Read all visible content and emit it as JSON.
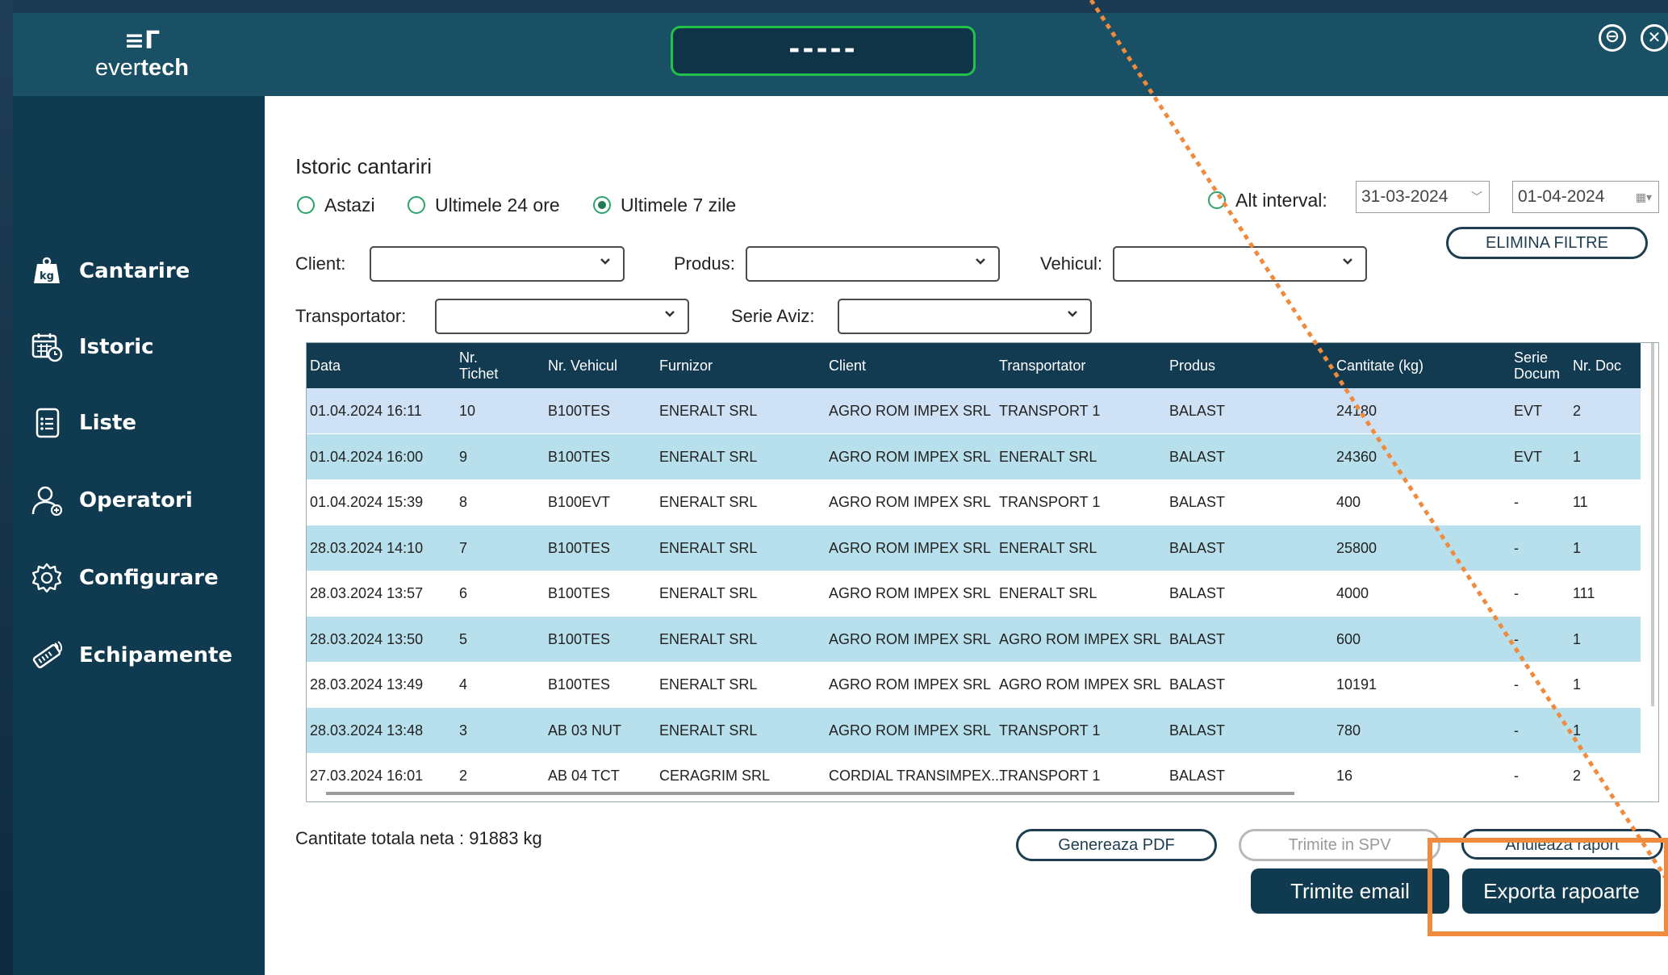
{
  "app": {
    "logo_mark": "≡Γ",
    "logo_prefix": "ever",
    "logo_bold": "tech",
    "scale_display": "-----"
  },
  "window": {
    "minimize": "⊖",
    "close": "✕"
  },
  "sidebar": {
    "items": [
      {
        "label": "Cantarire",
        "icon": "weight-scale-icon"
      },
      {
        "label": "Istoric",
        "icon": "calendar-history-icon"
      },
      {
        "label": "Liste",
        "icon": "list-document-icon"
      },
      {
        "label": "Operatori",
        "icon": "users-icon"
      },
      {
        "label": "Configurare",
        "icon": "gear-icon"
      },
      {
        "label": "Echipamente",
        "icon": "equipment-icon"
      }
    ]
  },
  "page": {
    "title": "Istoric cantariri"
  },
  "filters": {
    "ranges": [
      {
        "label": "Astazi",
        "selected": false
      },
      {
        "label": "Ultimele 24 ore",
        "selected": false
      },
      {
        "label": "Ultimele 7 zile",
        "selected": true
      }
    ],
    "alt_interval": {
      "label": "Alt interval:",
      "selected": false,
      "from": "31-03-2024",
      "to": "01-04-2024"
    },
    "clear_button": "ELIMINA FILTRE",
    "client_label": "Client:",
    "client_value": "",
    "produs_label": "Produs:",
    "produs_value": "",
    "vehicul_label": "Vehicul:",
    "vehicul_value": "",
    "transportator_label": "Transportator:",
    "transportator_value": "",
    "serie_label": "Serie Aviz:",
    "serie_value": ""
  },
  "table": {
    "columns": [
      "Data",
      "Nr.\nTichet",
      "Nr. Vehicul",
      "Furnizor",
      "Client",
      "Transportator",
      "Produs",
      "Cantitate (kg)",
      "Serie\nDocum",
      "Nr. Doc"
    ],
    "rows": [
      [
        "01.04.2024 16:11",
        "10",
        "B100TES",
        "ENERALT SRL",
        "AGRO ROM IMPEX SRL",
        "TRANSPORT 1",
        "BALAST",
        "24180",
        "EVT",
        "2"
      ],
      [
        "01.04.2024 16:00",
        "9",
        "B100TES",
        "ENERALT SRL",
        "AGRO ROM IMPEX SRL",
        "ENERALT SRL",
        "BALAST",
        "24360",
        "EVT",
        "1"
      ],
      [
        "01.04.2024 15:39",
        "8",
        "B100EVT",
        "ENERALT SRL",
        "AGRO ROM IMPEX SRL",
        "TRANSPORT 1",
        "BALAST",
        "400",
        "-",
        "11"
      ],
      [
        "28.03.2024 14:10",
        "7",
        "B100TES",
        "ENERALT SRL",
        "AGRO ROM IMPEX SRL",
        "ENERALT SRL",
        "BALAST",
        "25800",
        "-",
        "1"
      ],
      [
        "28.03.2024 13:57",
        "6",
        "B100TES",
        "ENERALT SRL",
        "AGRO ROM IMPEX SRL",
        "ENERALT SRL",
        "BALAST",
        "4000",
        "-",
        "111"
      ],
      [
        "28.03.2024 13:50",
        "5",
        "B100TES",
        "ENERALT SRL",
        "AGRO ROM IMPEX SRL",
        "AGRO ROM IMPEX SRL",
        "BALAST",
        "600",
        "-",
        "1"
      ],
      [
        "28.03.2024 13:49",
        "4",
        "B100TES",
        "ENERALT SRL",
        "AGRO ROM IMPEX SRL",
        "AGRO ROM IMPEX SRL",
        "BALAST",
        "10191",
        "-",
        "1"
      ],
      [
        "28.03.2024 13:48",
        "3",
        "AB 03 NUT",
        "ENERALT SRL",
        "AGRO ROM IMPEX SRL",
        "TRANSPORT 1",
        "BALAST",
        "780",
        "-",
        "1"
      ],
      [
        "27.03.2024 16:01",
        "2",
        "AB 04 TCT",
        "CERAGRIM SRL",
        "CORDIAL TRANSIMPEX...",
        "TRANSPORT 1",
        "BALAST",
        "16",
        "-",
        "2"
      ]
    ],
    "row_styles": [
      "sel",
      "alt",
      "plain",
      "alt",
      "plain",
      "alt",
      "plain",
      "alt",
      "plain"
    ]
  },
  "summary": {
    "total": "Cantitate totala neta : 91883 kg"
  },
  "actions": {
    "pdf": "Genereaza PDF",
    "spv": "Trimite in SPV",
    "cancel": "Anuleaza raport",
    "email": "Trimite email",
    "export": "Exporta rapoarte"
  },
  "colors": {
    "topbar": "#195066",
    "sidebar": "#0f3a4f",
    "header": "#123a50",
    "row_selected": "#cfe1f5",
    "row_alt": "#b7e0ec",
    "radio": "#2ba36a",
    "annotation": "#f08a3c"
  }
}
